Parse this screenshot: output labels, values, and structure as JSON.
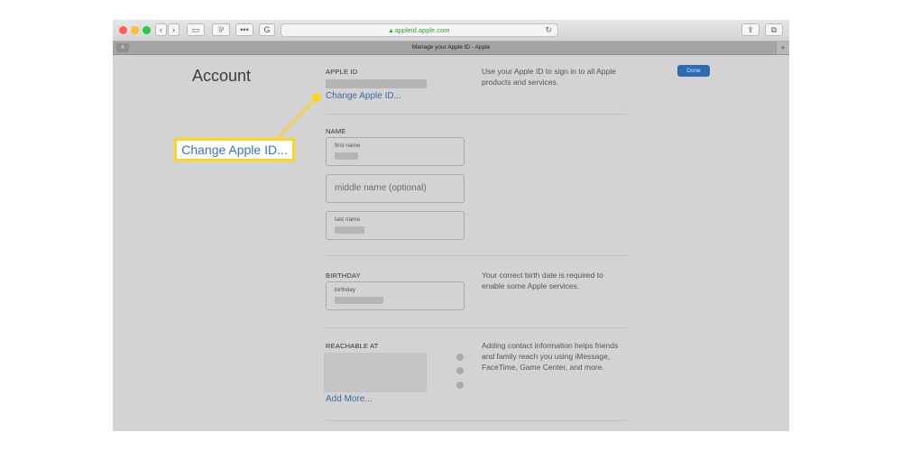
{
  "browser": {
    "url": "appleid.apple.com",
    "tab_title": "Manage your Apple ID - Apple",
    "tab_letter": "A",
    "add_tab_label": "+"
  },
  "page": {
    "title": "Account",
    "done_label": "Done",
    "apple_id": {
      "label": "APPLE ID",
      "change_link": "Change Apple ID...",
      "description": "Use your Apple ID to sign in to all Apple products and services."
    },
    "name": {
      "label": "NAME",
      "first_name_label": "first name",
      "middle_name_placeholder": "middle name (optional)",
      "last_name_label": "last name"
    },
    "birthday": {
      "label": "BIRTHDAY",
      "field_label": "birthday",
      "description": "Your correct birth date is required to enable some Apple services."
    },
    "reachable": {
      "label": "REACHABLE AT",
      "description": "Adding contact information helps friends and family reach you using iMessage, FaceTime, Game Center, and more.",
      "add_more": "Add More..."
    }
  },
  "callout": {
    "text": "Change Apple ID...",
    "color": "#ffd51a"
  }
}
